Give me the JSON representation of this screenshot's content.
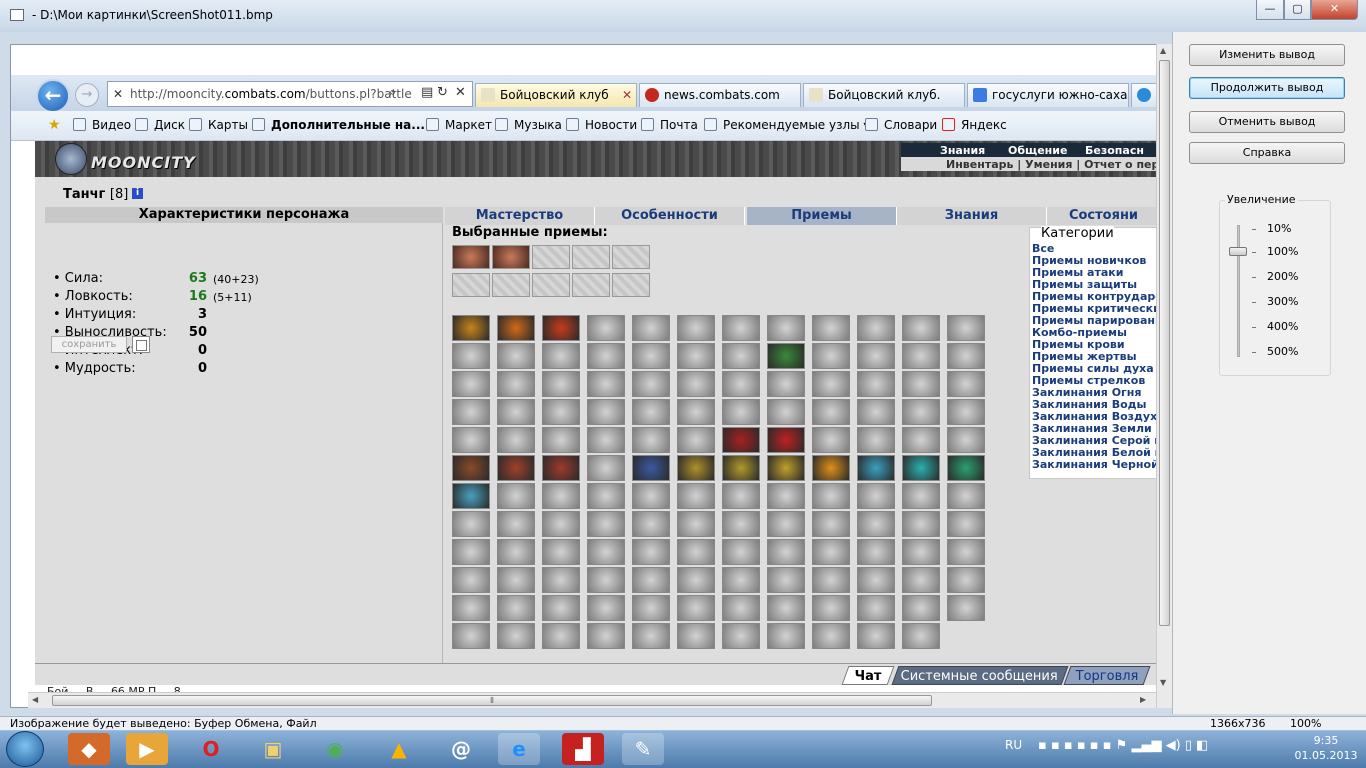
{
  "window": {
    "title": "- D:\\Мои картинки\\ScreenShot011.bmp",
    "min": "—",
    "max": "▢",
    "close": "✕"
  },
  "panel": {
    "buttons": [
      "Изменить вывод",
      "Продолжить вывод",
      "Отменить вывод",
      "Справка"
    ],
    "zoom_title": "Увеличение",
    "zoom_levels": [
      "10%",
      "100%",
      "200%",
      "300%",
      "400%",
      "500%"
    ],
    "zoom_selected": "100%"
  },
  "browser": {
    "url_prefix": "http://mooncity.",
    "url_domain": "combats.com",
    "url_rest": "/buttons.pl?battle",
    "tabs": [
      {
        "label": "Бойцовский клуб",
        "color": "#e9e2c6"
      },
      {
        "label": "news.combats.com",
        "color": "#c3291f"
      },
      {
        "label": "Бойцовский клуб.",
        "color": "#e9e2c6"
      },
      {
        "label": "госуслуги южно-сахал...",
        "color": "#3d7be0"
      },
      {
        "label": "Г",
        "color": "#2a8cd8"
      }
    ],
    "tab_close": "✕",
    "favorites": [
      "Видео",
      "Диск",
      "Карты",
      "Дополнительные на...",
      "Маркет",
      "Музыка",
      "Новости",
      "Почта",
      "Рекомендуемые узлы",
      "Словари",
      "Яндекс"
    ]
  },
  "game": {
    "logo": "MOONCITY",
    "menu_top": [
      "Знания",
      "Общение",
      "Безопасн"
    ],
    "menu_bottom": "Инвентарь | Умения | Отчет о перев",
    "char_name": "Танчг",
    "char_level": "[8]",
    "info_icon": "i",
    "char_header": "Характеристики персонажа",
    "stats": [
      {
        "label": "• Сила:",
        "value": "63",
        "extra": "(40+23)",
        "color": "#1b7a1b"
      },
      {
        "label": "• Ловкость:",
        "value": "16",
        "extra": "(5+11)",
        "color": "#1b7a1b"
      },
      {
        "label": "• Интуиция:",
        "value": "3",
        "extra": "",
        "color": "#000000"
      },
      {
        "label": "• Выносливость:",
        "value": "50",
        "extra": "",
        "color": "#000000"
      },
      {
        "label": "• Интеллект:",
        "value": "0",
        "extra": "",
        "color": "#000000"
      },
      {
        "label": "• Мудрость:",
        "value": "0",
        "extra": "",
        "color": "#000000"
      }
    ],
    "save_label": "сохранить",
    "tabs": [
      "Мастерство",
      "Особенности",
      "Приемы",
      "Знания",
      "Состояни"
    ],
    "active_tab": "Приемы",
    "selected_header": "Выбранные приемы:",
    "categories_title": "Категории",
    "categories": [
      "Все",
      "Приемы новичков",
      "Приемы атаки",
      "Приемы защиты",
      "Приемы контрударов",
      "Приемы критических",
      "Приемы парирования",
      "Комбо-приемы",
      "Приемы крови",
      "Приемы жертвы",
      "Приемы силы духа",
      "Приемы стрелков",
      "Заклинания Огня",
      "Заклинания Воды",
      "Заклинания Воздуха",
      "Заклинания Земли",
      "Заклинания Серой ма",
      "Заклинания Белой ма",
      "Заклинания Черной м"
    ],
    "chat_tabs": [
      "Чат",
      "Системные сообщения",
      "Торговля"
    ],
    "chat_line": "Бой ... В ... 66 MP  П ... 8"
  },
  "statusbar": {
    "text": "Изображение будет выведено: Буфер Обмена, Файл",
    "dims": "1366x736",
    "zoom": "100%"
  },
  "taskbar": {
    "lang": "RU",
    "time": "9:35",
    "date": "01.05.2013"
  }
}
